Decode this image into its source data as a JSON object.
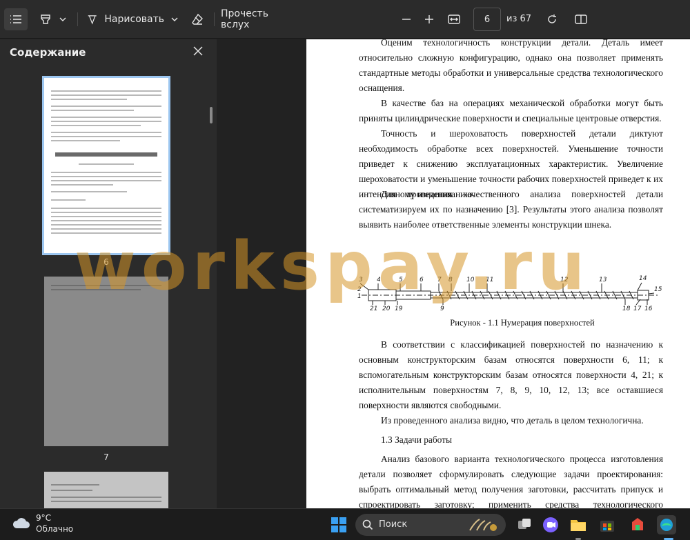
{
  "toolbar": {
    "draw_label": "Нарисовать",
    "read_aloud_label": "Прочесть вслух",
    "page_current": "6",
    "page_total": "из 67"
  },
  "sidebar": {
    "title": "Содержание",
    "thumbnails": [
      {
        "label": "6"
      },
      {
        "label": "7"
      }
    ]
  },
  "document": {
    "paragraphs": [
      "Оценим технологичность конструкции детали. Деталь имеет относительно сложную конфигурацию, однако она позволяет применять стандартные методы обработки и универсальные средства технологического оснащения.",
      "В качестве баз на операциях механической обработки могут быть приняты цилиндрические поверхности и специальные центровые отверстия.",
      "Точность и шероховатость поверхностей детали диктуют необходимость обработке всех поверхностей. Уменьшение точности приведет к снижению эксплуатационных характеристик. Увеличение шероховатости и уменьшение точности рабочих поверхностей приведет к их интенсивному изнашиванию.",
      "Для проведения качественного анализа поверхностей детали систематизируем их по назначению [3]. Результаты этого анализа позволят выявить наиболее ответственные элементы конструкции шнека.",
      "В соответствии с классификацией поверхностей по назначению к основным конструкторским базам относятся поверхности 6, 11; к вспомогательным конструкторским базам относятся поверхности 4, 21; к исполнительным поверхностям 7, 8, 9, 10, 12, 13; все оставшиеся поверхности являются свободными.",
      "Из проведенного анализа видно, что деталь в целом технологична.",
      "Анализ базового варианта технологического процесса изготовления детали позволяет сформулировать следующие задачи проектирования: выбрать оптимальный метод получения заготовки, рассчитать припуск и спроектировать заготовку; применить средства технологического оснащения, которые отвечали бы современным требованиям; спроектировать оснастку и инструмент для обеспечения совершенствования техпроцесса; провести анализ техпроцесса на"
    ],
    "section_heading": "1.3 Задачи работы",
    "figure_caption": "Рисунок - 1.1 Нумерация поверхностей",
    "figure_labels_top": [
      "3",
      "4",
      "5",
      "6",
      "7",
      "8",
      "10",
      "11",
      "12",
      "13",
      "14"
    ],
    "figure_labels_left": [
      "2",
      "1"
    ],
    "figure_labels_bottom": [
      "21",
      "20",
      "19",
      "9",
      "18",
      "17",
      "16"
    ],
    "figure_label_right": "15"
  },
  "watermark": "workspay.ru",
  "taskbar": {
    "weather_temp": "9°C",
    "weather_desc": "Облачно",
    "search_label": "Поиск"
  },
  "colors": {
    "toolbar_bg": "#2b2b2b",
    "selected_thumbnail_border": "#9cc6f0",
    "watermark": "#d69628"
  }
}
